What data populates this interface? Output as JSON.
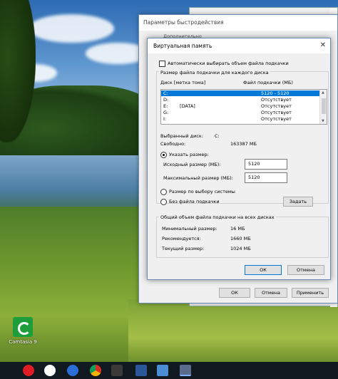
{
  "desktop": {
    "icon_label": "Camtasia 9"
  },
  "taskbar": {
    "items": [
      "opera-icon",
      "yandex-icon",
      "nav-icon",
      "chrome-icon",
      "app-icon",
      "word-icon",
      "screen-icon",
      "window-icon"
    ]
  },
  "perf_window": {
    "title": "Параметры быстродействия",
    "tab_text": "Дополнительно",
    "ok": "ОК",
    "cancel": "Отмена",
    "apply": "Применить"
  },
  "vm": {
    "title": "Виртуальная память",
    "auto_label": "Автоматически выбирать объем файла подкачки",
    "group_title": "Размер файла подкачки для каждого диска",
    "col_disk": "Диск [метка тома]",
    "col_size": "Файл подкачки (МБ)",
    "drives": [
      {
        "letter": "C:",
        "label": "",
        "size": "5120 - 5120",
        "selected": true
      },
      {
        "letter": "D:",
        "label": "",
        "size": "Отсутствует",
        "selected": false
      },
      {
        "letter": "E:",
        "label": "[DATA]",
        "size": "Отсутствует",
        "selected": false
      },
      {
        "letter": "G:",
        "label": "",
        "size": "Отсутствует",
        "selected": false
      },
      {
        "letter": "I:",
        "label": "",
        "size": "Отсутствует",
        "selected": false
      }
    ],
    "selected_disk_label": "Выбранный диск:",
    "selected_disk_value": "C:",
    "free_label": "Свободно:",
    "free_value": "163387 МБ",
    "custom_size": "Указать размер:",
    "initial_label": "Исходный размер (МБ):",
    "initial_value": "5120",
    "max_label": "Максимальный размер (МБ):",
    "max_value": "5120",
    "system_managed": "Размер по выбору системы",
    "no_paging": "Без файла подкачки",
    "set_button": "Задать",
    "total_group": "Общий объем файла подкачки на всех дисках",
    "min_label": "Минимальный размер:",
    "min_value": "16 МБ",
    "rec_label": "Рекомендуется:",
    "rec_value": "1660 МБ",
    "cur_label": "Текущий размер:",
    "cur_value": "1024 МБ",
    "ok": "ОК",
    "cancel": "Отмена"
  }
}
